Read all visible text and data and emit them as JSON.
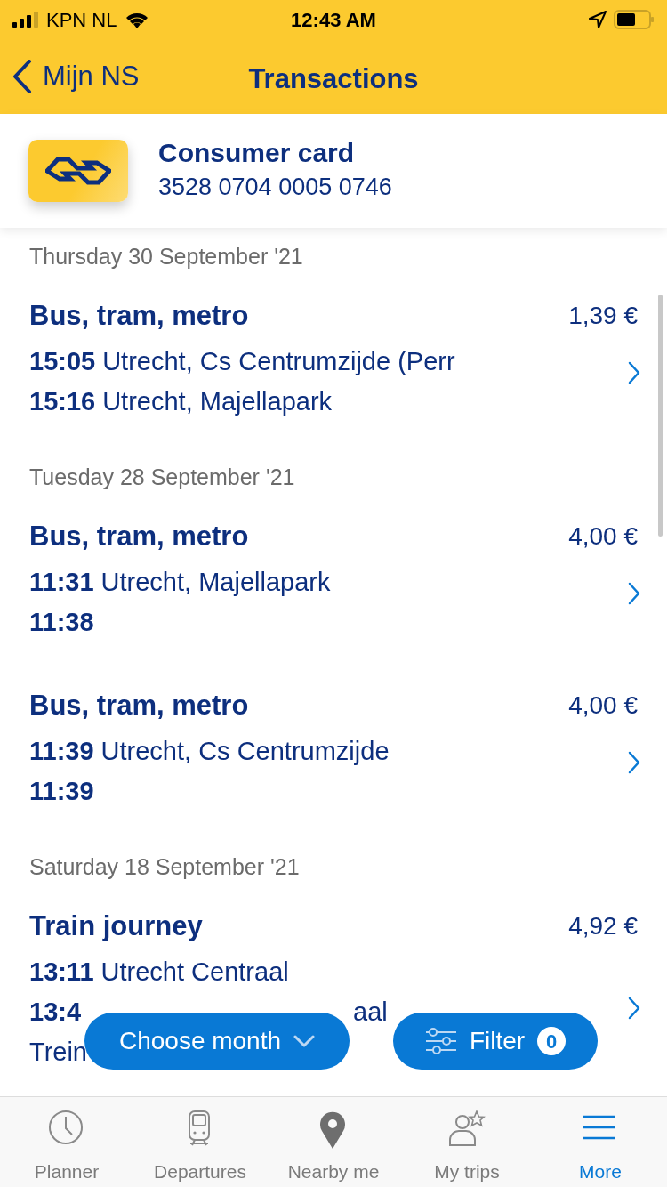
{
  "status_bar": {
    "carrier": "KPN NL",
    "time": "12:43 AM"
  },
  "nav": {
    "back": "Mijn NS",
    "title": "Transactions"
  },
  "card": {
    "name": "Consumer card",
    "number": "3528 0704 0005 0746"
  },
  "groups": [
    {
      "date": "Thursday 30 September '21",
      "transactions": [
        {
          "type": "Bus, tram, metro",
          "amount": "1,39 €",
          "lines": [
            {
              "time": "15:05",
              "place": "Utrecht, Cs Centrumzijde (Perr"
            },
            {
              "time": "15:16",
              "place": "Utrecht, Majellapark"
            }
          ]
        }
      ]
    },
    {
      "date": "Tuesday 28 September '21",
      "transactions": [
        {
          "type": "Bus, tram, metro",
          "amount": "4,00 €",
          "lines": [
            {
              "time": "11:31",
              "place": "Utrecht, Majellapark"
            },
            {
              "time": "11:38"
            }
          ]
        },
        {
          "type": "Bus, tram, metro",
          "amount": "4,00 €",
          "lines": [
            {
              "time": "11:39",
              "place": "Utrecht, Cs Centrumzijde"
            },
            {
              "time": "11:39"
            }
          ]
        }
      ]
    },
    {
      "date": "Saturday 18 September '21",
      "transactions": [
        {
          "type": "Train journey",
          "amount": "4,92 €",
          "lines": [
            {
              "time": "13:11",
              "place": "Utrecht Centraal"
            },
            {
              "time": "13:4",
              "place": "aal",
              "partly_hidden": true
            }
          ],
          "note": "Trein"
        }
      ]
    }
  ],
  "floating": {
    "month": "Choose month",
    "filter": "Filter",
    "filter_count": "0"
  },
  "tabs": [
    {
      "label": "Planner",
      "selected": false
    },
    {
      "label": "Departures",
      "selected": false
    },
    {
      "label": "Nearby me",
      "selected": false
    },
    {
      "label": "My trips",
      "selected": false
    },
    {
      "label": "More",
      "selected": true
    }
  ]
}
